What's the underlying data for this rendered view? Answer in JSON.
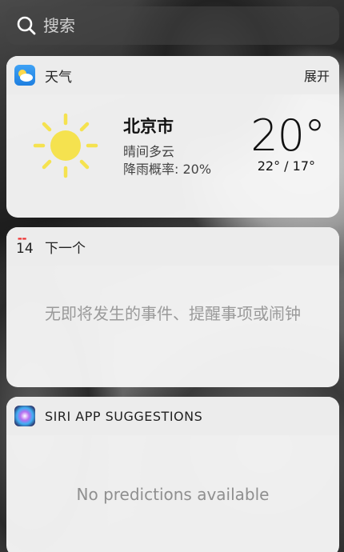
{
  "search": {
    "placeholder": "搜索"
  },
  "weather": {
    "app_name": "天气",
    "expand_label": "展开",
    "city": "北京市",
    "condition": "晴间多云",
    "rain_chance": "降雨概率: 20%",
    "temperature": "20°",
    "range": "22° / 17°",
    "icon": "sun-icon",
    "sun_color": "#F5E24F"
  },
  "up_next": {
    "app_name": "下一个",
    "calendar_day": "14",
    "empty_message": "无即将发生的事件、提醒事项或闹钟"
  },
  "siri": {
    "app_name": "SIRI APP SUGGESTIONS",
    "empty_message": "No predictions available"
  }
}
